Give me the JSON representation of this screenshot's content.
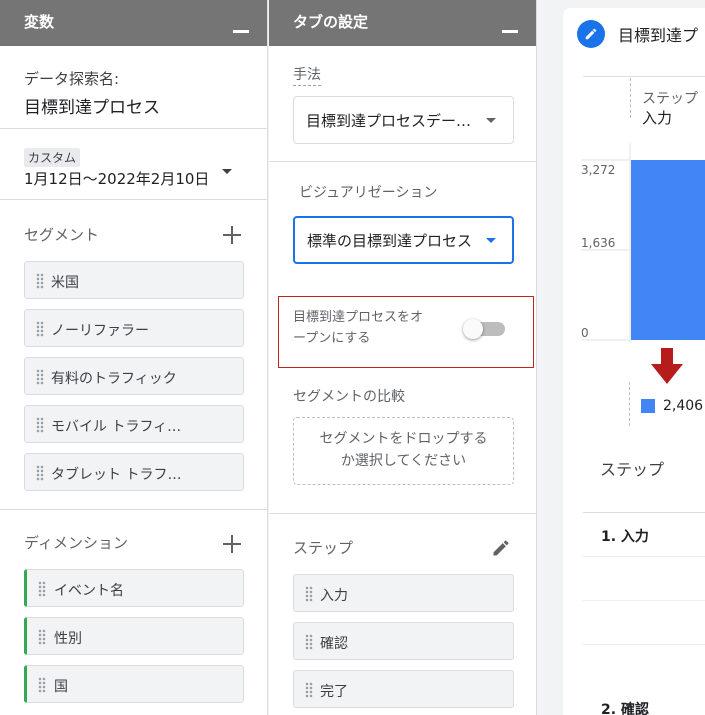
{
  "variables_panel": {
    "title": "変数",
    "exploration_label": "データ探索名:",
    "exploration_name": "目標到達プロセス",
    "date_badge": "カスタム",
    "date_range": "1月12日～2022年2月10日",
    "segments_label": "セグメント",
    "segments": [
      "米国",
      "ノーリファラー",
      "有料のトラフィック",
      "モバイル トラフィ…",
      "タブレット トラフ…"
    ],
    "dimensions_label": "ディメンション",
    "dimensions": [
      "イベント名",
      "性別",
      "国"
    ]
  },
  "tab_settings": {
    "title": "タブの設定",
    "technique_label": "手法",
    "technique_value": "目標到達プロセスデー…",
    "visualization_label": "ビジュアリゼーション",
    "visualization_value": "標準の目標到達プロセス",
    "open_funnel_label_line1": "目標到達プロセスをオ",
    "open_funnel_label_line2": "ープンにする",
    "open_funnel_enabled": false,
    "segment_comparison_label": "セグメントの比較",
    "segment_drop_line1": "セグメントをドロップする",
    "segment_drop_line2": "か選択してください",
    "steps_label": "ステップ",
    "steps": [
      "入力",
      "確認",
      "完了"
    ]
  },
  "report": {
    "title": "目標到達プ",
    "step_header_label": "ステップ",
    "step_header_value": "入力",
    "table_header": "ステップ",
    "rows": [
      "1. 入力",
      "2. 確認"
    ],
    "legend_value": "2,406"
  },
  "chart_data": {
    "type": "bar",
    "categories": [
      "入力"
    ],
    "values": [
      3272
    ],
    "y_ticks": [
      "3,272",
      "1,636",
      "0"
    ],
    "ylim": [
      0,
      3272
    ],
    "bar_color": "#4285f4"
  },
  "colors": {
    "header_bg": "#757575",
    "accent_blue": "#1a73e8",
    "dimension_green": "#34a853",
    "highlight_red": "#c5221f",
    "dropoff_red": "#b71c1c"
  }
}
